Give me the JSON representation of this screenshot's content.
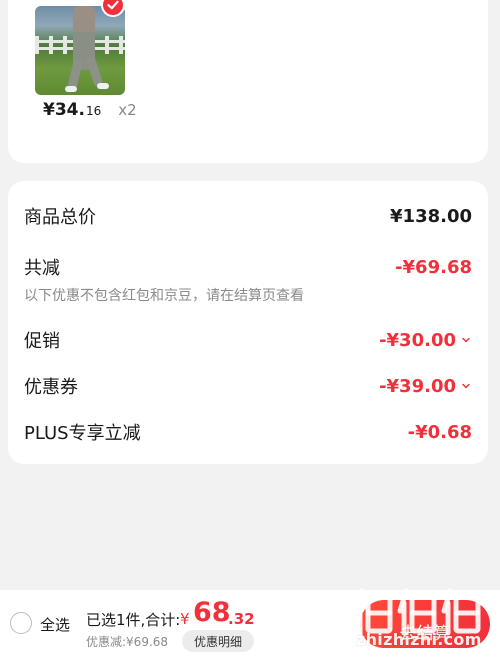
{
  "product": {
    "price_main": "¥34.",
    "price_decimal": "16",
    "quantity": "x2",
    "selected": true
  },
  "summary": {
    "total_label": "商品总价",
    "total_value": "¥138.00",
    "reduce_label": "共减",
    "reduce_value": "-¥69.68",
    "note": "以下优惠不包含红包和京豆，请在结算页查看",
    "promo_label": "促销",
    "promo_value": "-¥30.00",
    "coupon_label": "优惠券",
    "coupon_value": "-¥39.00",
    "plus_label": "PLUS专享立减",
    "plus_value": "-¥0.68"
  },
  "bottom": {
    "select_all": "全选",
    "selected_count": "已选1件,合计:",
    "currency": "¥",
    "total_int": "68",
    "total_dec": ".32",
    "discount_note": "优惠减:¥69.68",
    "detail_button": "优惠明细",
    "checkout_button": "去结算"
  },
  "watermark": {
    "text": "zhizhizhi.com"
  },
  "colors": {
    "accent_red": "#f2303b",
    "background": "#f2f2f2"
  }
}
